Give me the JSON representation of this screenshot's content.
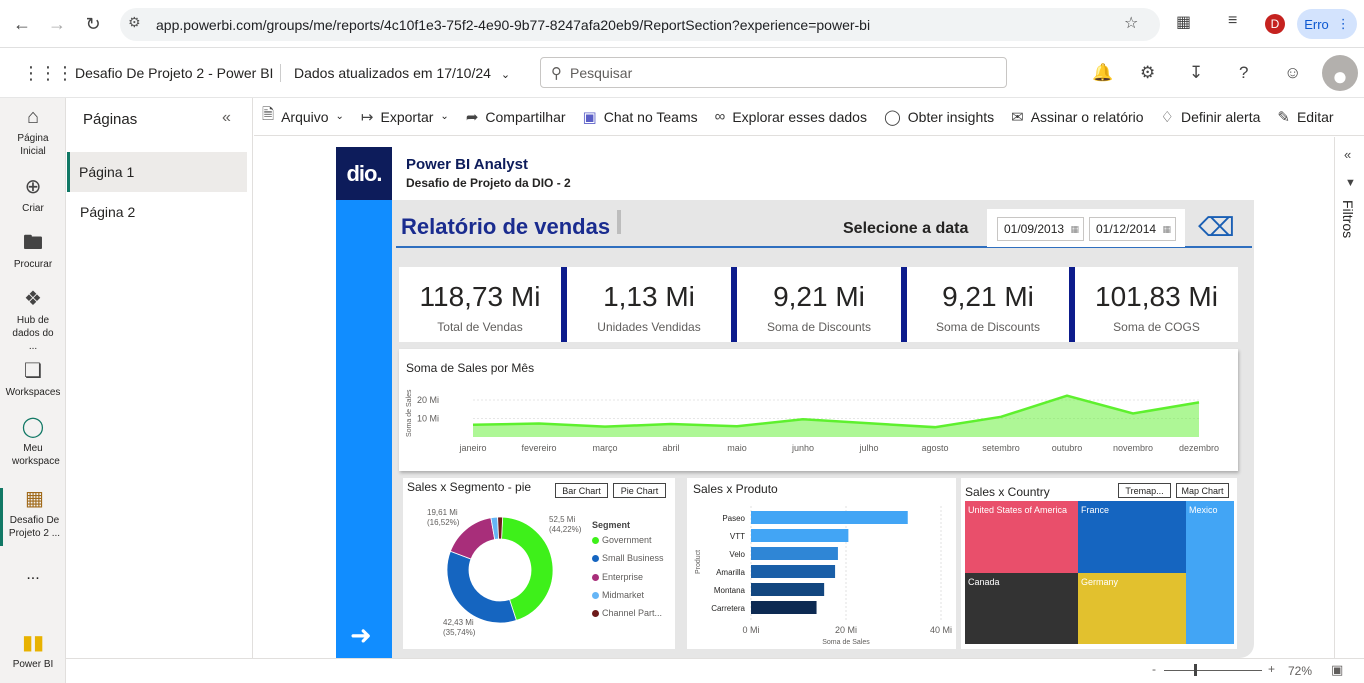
{
  "browser": {
    "url": "app.powerbi.com/groups/me/reports/4c10f1e3-75f2-4e90-9b77-8247afa20eb9/ReportSection?experience=power-bi",
    "profile_letter": "D",
    "error_chip": "Erro"
  },
  "header": {
    "report_name": "Desafio De Projeto 2 - Power BI",
    "updated": "Dados atualizados em 17/10/24",
    "search_placeholder": "Pesquisar"
  },
  "rail": {
    "items": [
      {
        "label": "Página Inicial",
        "icon": "home-icon"
      },
      {
        "label": "Criar",
        "icon": "plus-circle-icon"
      },
      {
        "label": "Procurar",
        "icon": "folder-icon"
      },
      {
        "label": "Hub de dados do ...",
        "icon": "data-hub-icon"
      },
      {
        "label": "Workspaces",
        "icon": "workspaces-icon"
      },
      {
        "label": "Meu workspace",
        "icon": "person-icon"
      },
      {
        "label": "Desafio De Projeto 2 ...",
        "icon": "report-icon"
      }
    ],
    "more": "...",
    "brand": "Power BI"
  },
  "pages": {
    "title": "Páginas",
    "items": [
      "Página 1",
      "Página 2"
    ]
  },
  "toolbar": {
    "items": [
      {
        "label": "Arquivo",
        "icon": "file-icon"
      },
      {
        "label": "Exportar",
        "icon": "export-icon"
      },
      {
        "label": "Compartilhar",
        "icon": "share-icon"
      },
      {
        "label": "Chat no Teams",
        "icon": "teams-icon"
      },
      {
        "label": "Explorar esses dados",
        "icon": "binoculars-icon"
      },
      {
        "label": "Obter insights",
        "icon": "lightbulb-icon"
      },
      {
        "label": "Assinar o relatório",
        "icon": "subscribe-icon"
      },
      {
        "label": "Definir alerta",
        "icon": "bell-icon"
      },
      {
        "label": "Editar",
        "icon": "pencil-icon"
      }
    ]
  },
  "filters": {
    "label": "Filtros"
  },
  "status": {
    "zoom": "72%",
    "minus": "-",
    "plus": "+"
  },
  "report": {
    "logo": "dio.",
    "title": "Power BI Analyst",
    "subtitle": "Desafio de Projeto da DIO - 2",
    "heading": "Relatório de vendas",
    "date_label": "Selecione a data",
    "date_start": "01/09/2013",
    "date_end": "01/12/2014",
    "kpis": [
      {
        "value": "118,73 Mi",
        "label": "Total de Vendas"
      },
      {
        "value": "1,13 Mi",
        "label": "Unidades Vendidas"
      },
      {
        "value": "9,21 Mi",
        "label": "Soma de Discounts"
      },
      {
        "value": "9,21 Mi",
        "label": "Soma de Discounts"
      },
      {
        "value": "101,83 Mi",
        "label": "Soma de COGS"
      }
    ],
    "pie_title": "Sales x Segmento - pie",
    "pie_btn_bar": "Bar Chart",
    "pie_btn_pie": "Pie Chart",
    "pie_legend_title": "Segment",
    "bar_title": "Sales x Produto",
    "map_title": "Sales x Country",
    "map_btn_tree": "Tremap...",
    "map_btn_map": "Map Chart"
  },
  "chart_data": [
    {
      "type": "area",
      "title": "Soma de Sales por Mês",
      "ylabel": "Soma de Sales",
      "yticks": [
        "10 Mi",
        "20 Mi"
      ],
      "ylim": [
        0,
        27
      ],
      "categories": [
        "janeiro",
        "fevereiro",
        "março",
        "abril",
        "maio",
        "junho",
        "julho",
        "agosto",
        "setembro",
        "outubro",
        "novembro",
        "dezembro"
      ],
      "values": [
        6.6,
        7.3,
        5.6,
        7.0,
        5.8,
        9.6,
        7.4,
        5.3,
        10.9,
        22.3,
        12.7,
        18.7
      ],
      "color": "#5ef02e"
    },
    {
      "type": "pie",
      "title": "Sales x Segmento - pie",
      "categories": [
        "Government",
        "Small Business",
        "Enterprise",
        "Midmarket",
        "Channel Part..."
      ],
      "values": [
        52.5,
        42.43,
        19.61,
        2.4,
        1.8
      ],
      "labels": [
        {
          "value": "52,5 Mi",
          "pct": "(44,22%)"
        },
        {
          "value": "42,43 Mi",
          "pct": "(35,74%)"
        },
        {
          "value": "19,61 Mi",
          "pct": "(16,52%)"
        }
      ],
      "colors": [
        "#3ef01a",
        "#1565c0",
        "#a82e7a",
        "#65b5f6",
        "#6d1a1a"
      ]
    },
    {
      "type": "bar",
      "title": "Sales x Produto",
      "xlabel": "Soma de Sales",
      "ylabel": "Product",
      "xticks": [
        "0 Mi",
        "20 Mi",
        "40 Mi"
      ],
      "xlim": [
        0,
        40
      ],
      "categories": [
        "Paseo",
        "VTT",
        "Velo",
        "Amarilla",
        "Montana",
        "Carretera"
      ],
      "values": [
        33.0,
        20.5,
        18.3,
        17.7,
        15.4,
        13.8
      ],
      "colors": [
        "#42a5f5",
        "#42a5f5",
        "#2f86d6",
        "#1a5fa8",
        "#12467f",
        "#0d2a52"
      ]
    },
    {
      "type": "treemap",
      "title": "Sales x Country",
      "categories": [
        "United States of America",
        "France",
        "Mexico",
        "Canada",
        "Germany"
      ],
      "colors": [
        "#e94f6b",
        "#1565c0",
        "#42a5f5",
        "#333333",
        "#e2c12e"
      ]
    }
  ]
}
